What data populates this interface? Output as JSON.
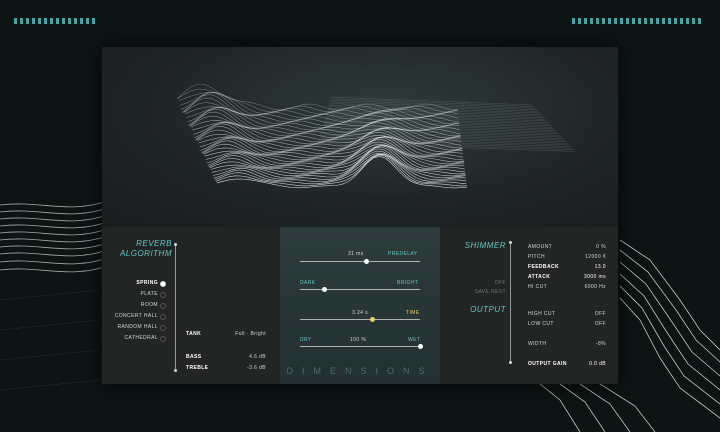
{
  "algorithm": {
    "title_line1": "REVERB",
    "title_line2": "ALGORITHM",
    "options": [
      "SPRING",
      "PLATE",
      "ROOM",
      "CONCERT HALL",
      "RANDOM HALL",
      "CATHEDRAL"
    ],
    "selected": "SPRING",
    "params": [
      {
        "label": "TANK",
        "value": "Full · Bright"
      },
      {
        "label": "BASS",
        "value": "4.6 dB"
      },
      {
        "label": "TREBLE",
        "value": "-3.6 dB"
      }
    ]
  },
  "center": {
    "predelay": {
      "value": "31 ms",
      "label": "PREDELAY",
      "level": 0.55
    },
    "dark_bright": {
      "left": "DARK",
      "right": "BRIGHT",
      "level": 0.2
    },
    "time": {
      "value": "3.24 s",
      "label": "TIME",
      "level": 0.6
    },
    "dry_wet": {
      "left": "DRY",
      "value": "100 %",
      "right": "WET",
      "level": 1.0
    },
    "brand": "DIMENSIONS"
  },
  "shimmer": {
    "title": "SHIMMER",
    "side_labels": [
      "OFF",
      "SAVE NEXT"
    ],
    "params": [
      {
        "label": "AMOUNT",
        "value": "0 %"
      },
      {
        "label": "PITCH",
        "value": "12000 ¢"
      },
      {
        "label": "FEEDBACK",
        "value": "13.0"
      },
      {
        "label": "ATTACK",
        "value": "3000 ms"
      },
      {
        "label": "HI CUT",
        "value": "6000 Hz"
      }
    ]
  },
  "output": {
    "title": "OUTPUT",
    "params": [
      {
        "label": "HIGH CUT",
        "value": "OFF"
      },
      {
        "label": "LOW CUT",
        "value": "OFF"
      },
      {
        "label": "WIDTH",
        "value": "-8%"
      },
      {
        "label": "OUTPUT GAIN",
        "value": "0.0 dB"
      }
    ]
  },
  "colors": {
    "accent": "#5fc9c4",
    "panel": "#232525",
    "knob": "#ffffff"
  }
}
